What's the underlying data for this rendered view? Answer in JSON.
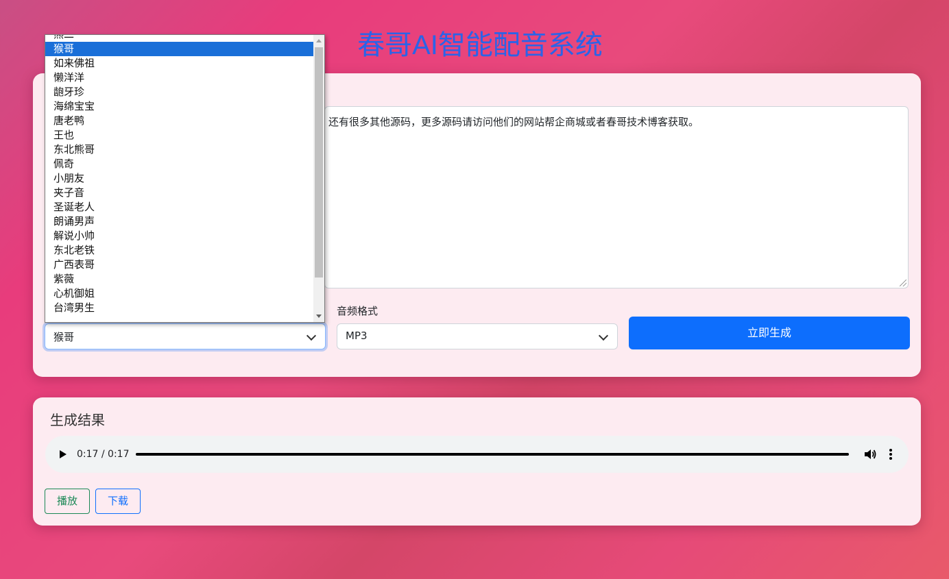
{
  "page": {
    "title": "春哥AI智能配音系统"
  },
  "form": {
    "text_value": "还有很多其他源码，更多源码请访问他们的网站帮企商城或者春哥技术博客获取。",
    "voice_select_value": "猴哥",
    "format_label": "音频格式",
    "format_select_value": "MP3",
    "generate_button": "立即生成"
  },
  "voice_options": [
    "熊二",
    "猴哥",
    "如来佛祖",
    "懒洋洋",
    "龅牙珍",
    "海绵宝宝",
    "唐老鸭",
    "王也",
    "东北熊哥",
    "佩奇",
    "小朋友",
    "夹子音",
    "圣诞老人",
    "朗诵男声",
    "解说小帅",
    "东北老铁",
    "广西表哥",
    "紫薇",
    "心机御姐",
    "台湾男生"
  ],
  "selected_voice_index": 1,
  "result": {
    "title": "生成结果",
    "audio_time": "0:17 / 0:17",
    "play_button": "播放",
    "download_button": "下载"
  },
  "colors": {
    "title": "#2b63e8",
    "primary": "#0d6efd",
    "success": "#198754",
    "card_bg": "#fdebf1"
  }
}
